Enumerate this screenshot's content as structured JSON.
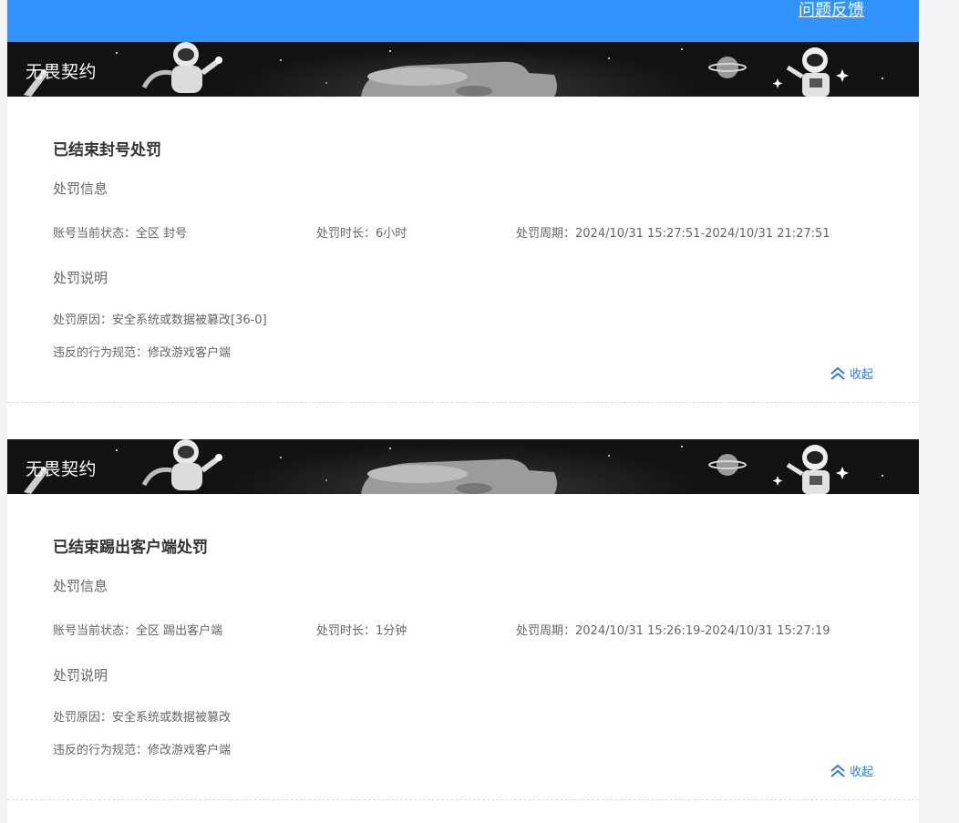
{
  "header": {
    "feedback_link": "问题反馈"
  },
  "cards": [
    {
      "game_name": "无畏契约",
      "title": "已结束封号处罚",
      "info_heading": "处罚信息",
      "status": "账号当前状态：全区 封号",
      "duration": "处罚时长：6小时",
      "period": "处罚周期：2024/10/31 15:27:51-2024/10/31 21:27:51",
      "desc_heading": "处罚说明",
      "reason": "处罚原因：安全系统或数据被篡改[36-0]",
      "rule": "违反的行为规范：修改游戏客户端",
      "collapse": "收起"
    },
    {
      "game_name": "无畏契约",
      "title": "已结束踢出客户端处罚",
      "info_heading": "处罚信息",
      "status": "账号当前状态：全区 踢出客户端",
      "duration": "处罚时长：1分钟",
      "period": "处罚周期：2024/10/31 15:26:19-2024/10/31 15:27:19",
      "desc_heading": "处罚说明",
      "reason": "处罚原因：安全系统或数据被篡改",
      "rule": "违反的行为规范：修改游戏客户端",
      "collapse": "收起"
    }
  ],
  "colors": {
    "header_bg": "#3193ff",
    "banner_bg": "#121212",
    "link": "#2f7ce8"
  },
  "icons": {
    "collapse": "double-chevron-up-icon"
  }
}
